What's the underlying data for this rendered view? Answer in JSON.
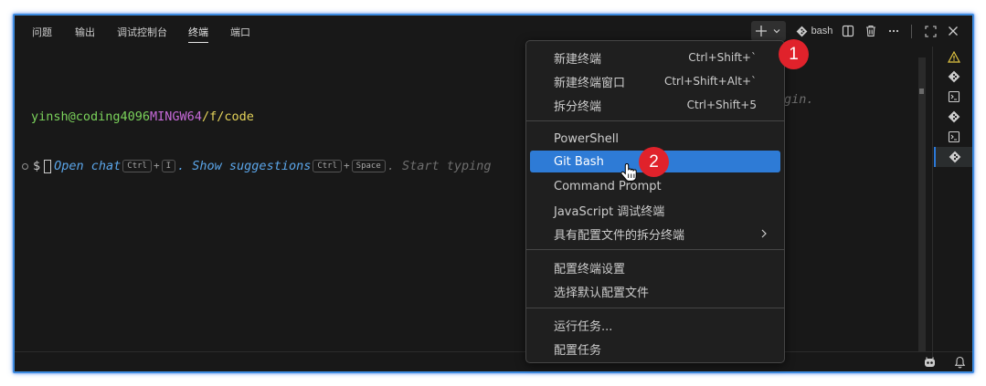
{
  "tabs": [
    {
      "label": "问题"
    },
    {
      "label": "输出"
    },
    {
      "label": "调试控制台"
    },
    {
      "label": "终端"
    },
    {
      "label": "端口"
    }
  ],
  "toolbar": {
    "new_terminal_icon": "plus-icon",
    "profile_label": "bash"
  },
  "terminal": {
    "user_host": "yinsh@coding4096",
    "env": "MINGW64",
    "path": "/f/code",
    "prompt": "$",
    "hint_open_chat": "Open chat",
    "key_ctrl": "Ctrl",
    "key_plus": "+",
    "key_i": "I",
    "hint_show_suggestions": ". Show suggestions",
    "key_space": "Space",
    "hint_start_typing": ". Start typing",
    "hint_tail": "gin."
  },
  "menu": {
    "group1": [
      {
        "label": "新建终端",
        "shortcut": "Ctrl+Shift+`"
      },
      {
        "label": "新建终端窗口",
        "shortcut": "Ctrl+Shift+Alt+`"
      },
      {
        "label": "拆分终端",
        "shortcut": "Ctrl+Shift+5"
      }
    ],
    "group2": [
      {
        "label": "PowerShell"
      },
      {
        "label": "Git Bash"
      },
      {
        "label": "Command Prompt"
      },
      {
        "label": "JavaScript 调试终端"
      },
      {
        "label": "具有配置文件的拆分终端"
      }
    ],
    "group3": [
      {
        "label": "配置终端设置"
      },
      {
        "label": "选择默认配置文件"
      }
    ],
    "group4": [
      {
        "label": "运行任务..."
      },
      {
        "label": "配置任务"
      }
    ]
  },
  "badges": [
    "1",
    "2"
  ],
  "colors": {
    "accent": "#2e7bd6",
    "badge": "#e0222b",
    "warning": "#e2c541"
  }
}
